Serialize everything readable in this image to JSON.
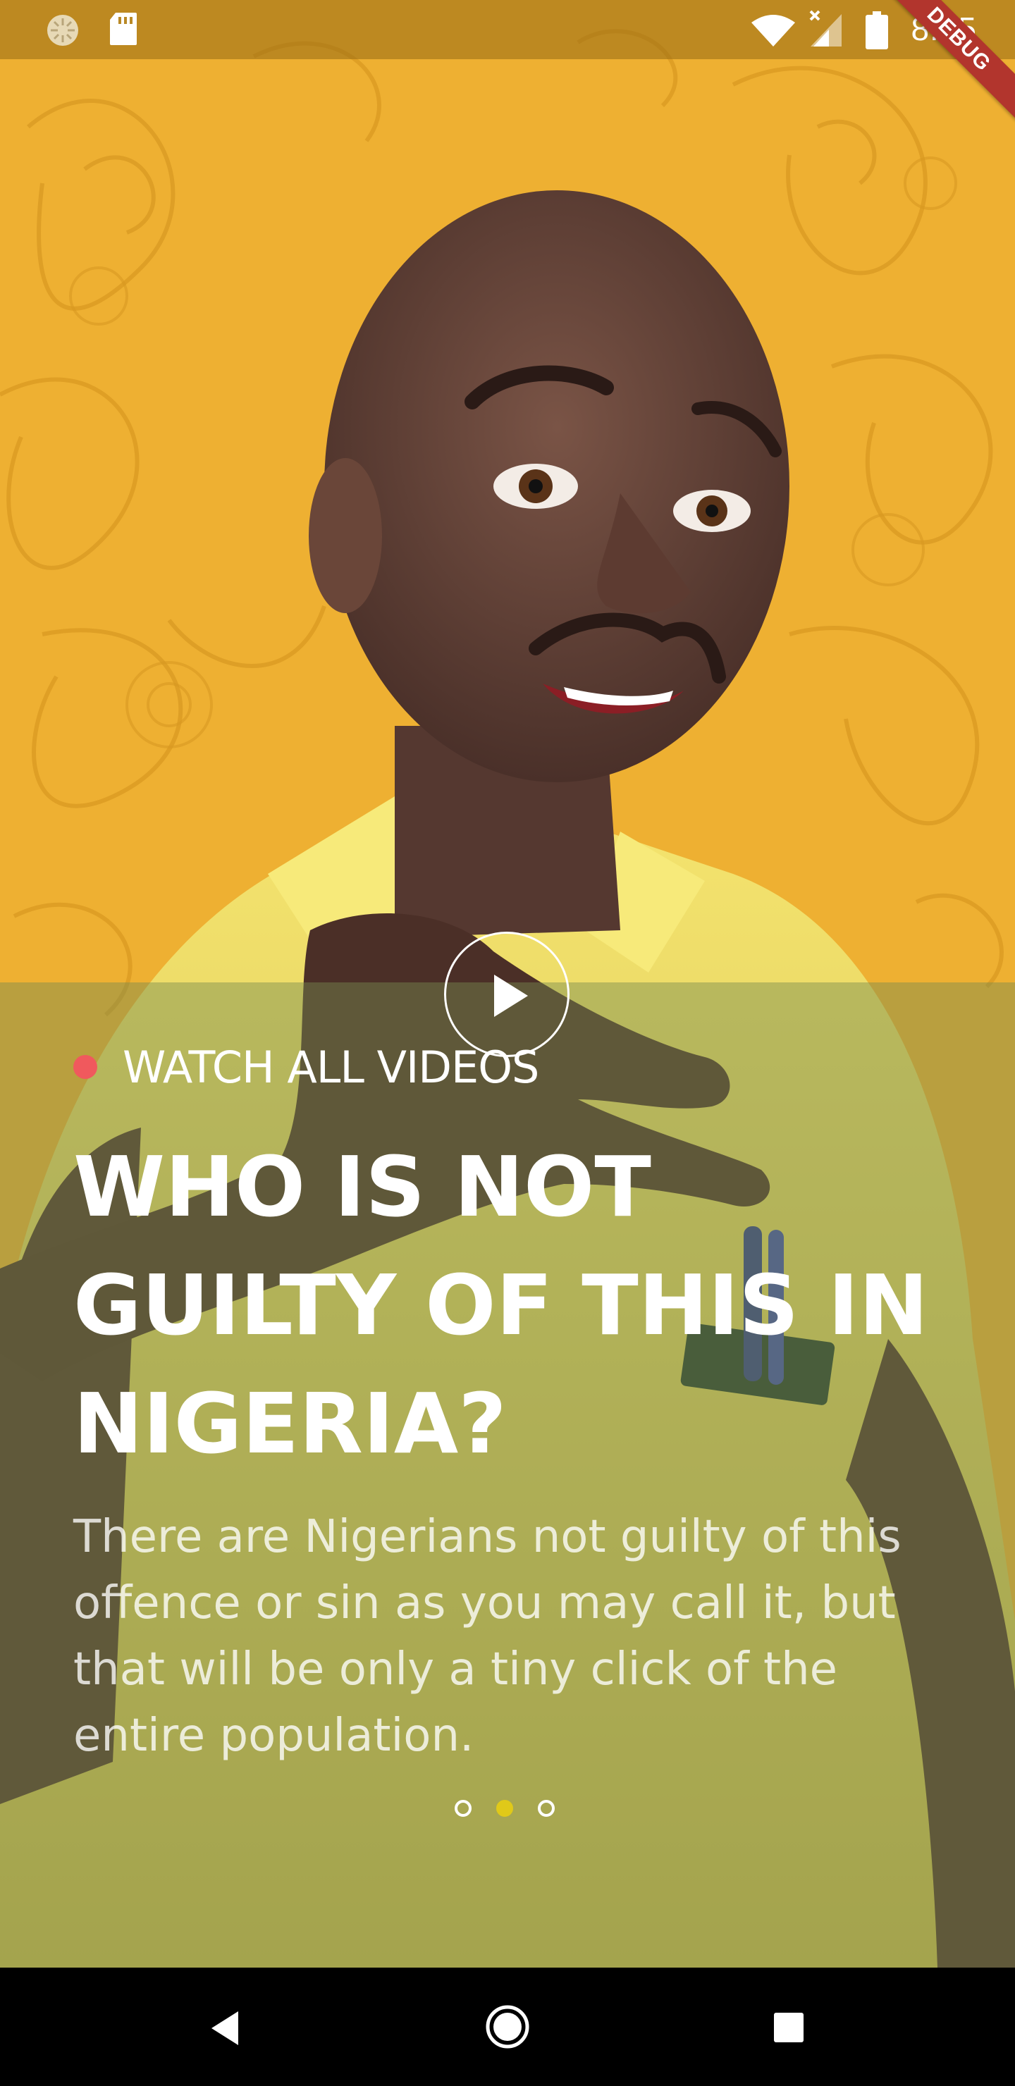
{
  "status_bar": {
    "time": "8:45",
    "debug_label": "DEBUG",
    "icons": [
      "loading-spinner-icon",
      "sd-card-icon",
      "wifi-icon",
      "signal-icon",
      "battery-icon"
    ]
  },
  "hero": {
    "background_color": "#eeb032",
    "image_description_icon": "cartoon-character"
  },
  "card": {
    "watch_label": "WATCH ALL VIDEOS",
    "dot_color": "#f0595d",
    "headline_lines": [
      "WHO IS NOT",
      "GUILTY OF THIS IN",
      "NIGERIA?"
    ],
    "description": "There are Nigerians not guilty of this offence or sin as you may call it, but that will be only a tiny click of the entire population.",
    "play_icon": "play-icon"
  },
  "pager": {
    "count": 3,
    "active_index": 1,
    "active_color": "#e0c919"
  },
  "nav_bar": {
    "icons": [
      "back-icon",
      "home-icon",
      "recents-icon"
    ]
  }
}
